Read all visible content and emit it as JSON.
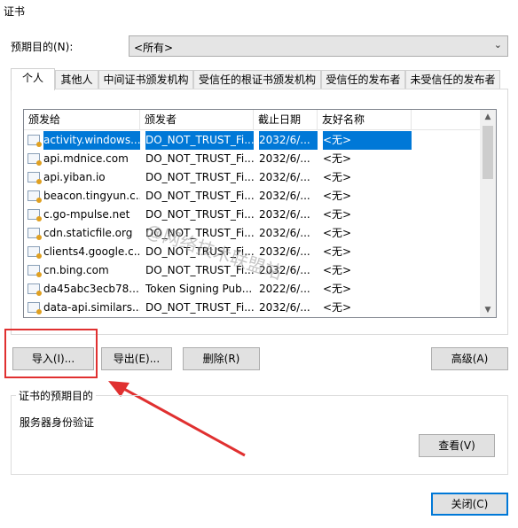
{
  "window": {
    "title": "证书"
  },
  "purpose": {
    "label": "预期目的(N):",
    "value": "<所有>"
  },
  "tabs": [
    {
      "label": "个人"
    },
    {
      "label": "其他人"
    },
    {
      "label": "中间证书颁发机构"
    },
    {
      "label": "受信任的根证书颁发机构"
    },
    {
      "label": "受信任的发布者"
    },
    {
      "label": "未受信任的发布者"
    }
  ],
  "list": {
    "columns": [
      "颁发给",
      "颁发者",
      "截止日期",
      "友好名称"
    ],
    "rows": [
      {
        "issued_to": "activity.windows....",
        "issuer": "DO_NOT_TRUST_Fi...",
        "expires": "2032/6/...",
        "name": "<无>"
      },
      {
        "issued_to": "api.mdnice.com",
        "issuer": "DO_NOT_TRUST_Fi...",
        "expires": "2032/6/...",
        "name": "<无>"
      },
      {
        "issued_to": "api.yiban.io",
        "issuer": "DO_NOT_TRUST_Fi...",
        "expires": "2032/6/...",
        "name": "<无>"
      },
      {
        "issued_to": "beacon.tingyun.c...",
        "issuer": "DO_NOT_TRUST_Fi...",
        "expires": "2032/6/...",
        "name": "<无>"
      },
      {
        "issued_to": "c.go-mpulse.net",
        "issuer": "DO_NOT_TRUST_Fi...",
        "expires": "2032/6/...",
        "name": "<无>"
      },
      {
        "issued_to": "cdn.staticfile.org",
        "issuer": "DO_NOT_TRUST_Fi...",
        "expires": "2032/6/...",
        "name": "<无>"
      },
      {
        "issued_to": "clients4.google.c...",
        "issuer": "DO_NOT_TRUST_Fi...",
        "expires": "2032/6/...",
        "name": "<无>"
      },
      {
        "issued_to": "cn.bing.com",
        "issuer": "DO_NOT_TRUST_Fi...",
        "expires": "2032/6/...",
        "name": "<无>"
      },
      {
        "issued_to": "da45abc3ecb78...",
        "issuer": "Token Signing Pub...",
        "expires": "2022/6/...",
        "name": "<无>"
      },
      {
        "issued_to": "data-api.similars...",
        "issuer": "DO_NOT_TRUST_Fi...",
        "expires": "2032/6/...",
        "name": "<无>"
      }
    ]
  },
  "buttons": {
    "import": "导入(I)...",
    "export": "导出(E)...",
    "delete": "删除(R)",
    "advanced": "高级(A)",
    "view": "查看(V)",
    "close": "关闭(C)"
  },
  "group": {
    "title": "证书的预期目的",
    "text": "服务器身份验证"
  },
  "watermark": "@网络技术联盟站",
  "colors": {
    "selection": "#0078d7",
    "annotation": "#e03030"
  }
}
